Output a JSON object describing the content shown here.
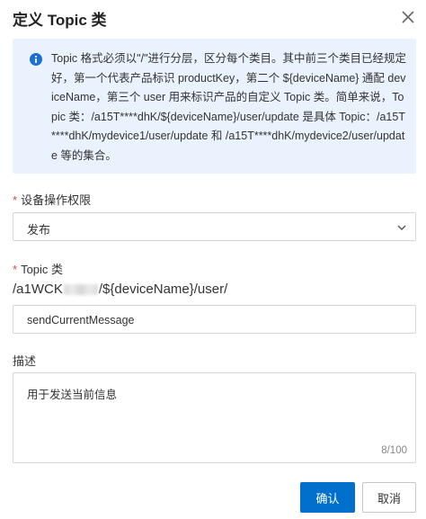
{
  "dialog": {
    "title": "定义 Topic 类"
  },
  "notice": {
    "text": "Topic 格式必须以\"/\"进行分层，区分每个类目。其中前三个类目已经规定好，第一个代表产品标识 productKey，第二个 ${deviceName} 通配 deviceName，第三个 user 用来标识产品的自定义 Topic 类。简单来说，Topic 类：/a15T****dhK/${deviceName}/user/update 是具体 Topic：/a15T****dhK/mydevice1/user/update 和 /a15T****dhK/mydevice2/user/update 等的集合。",
    "icon": "info-icon",
    "accent_color": "#1b6fd6"
  },
  "form": {
    "required_mark": "*",
    "permission": {
      "label": "设备操作权限",
      "value": "发布"
    },
    "topic": {
      "label": "Topic 类",
      "prefix_start": "/a1WCK",
      "prefix_end": "/${deviceName}/user/",
      "value": "sendCurrentMessage"
    },
    "description": {
      "label": "描述",
      "value": "用于发送当前信息",
      "counter": "8/100"
    }
  },
  "footer": {
    "confirm_label": "确认",
    "cancel_label": "取消",
    "primary_color": "#0070cc"
  }
}
